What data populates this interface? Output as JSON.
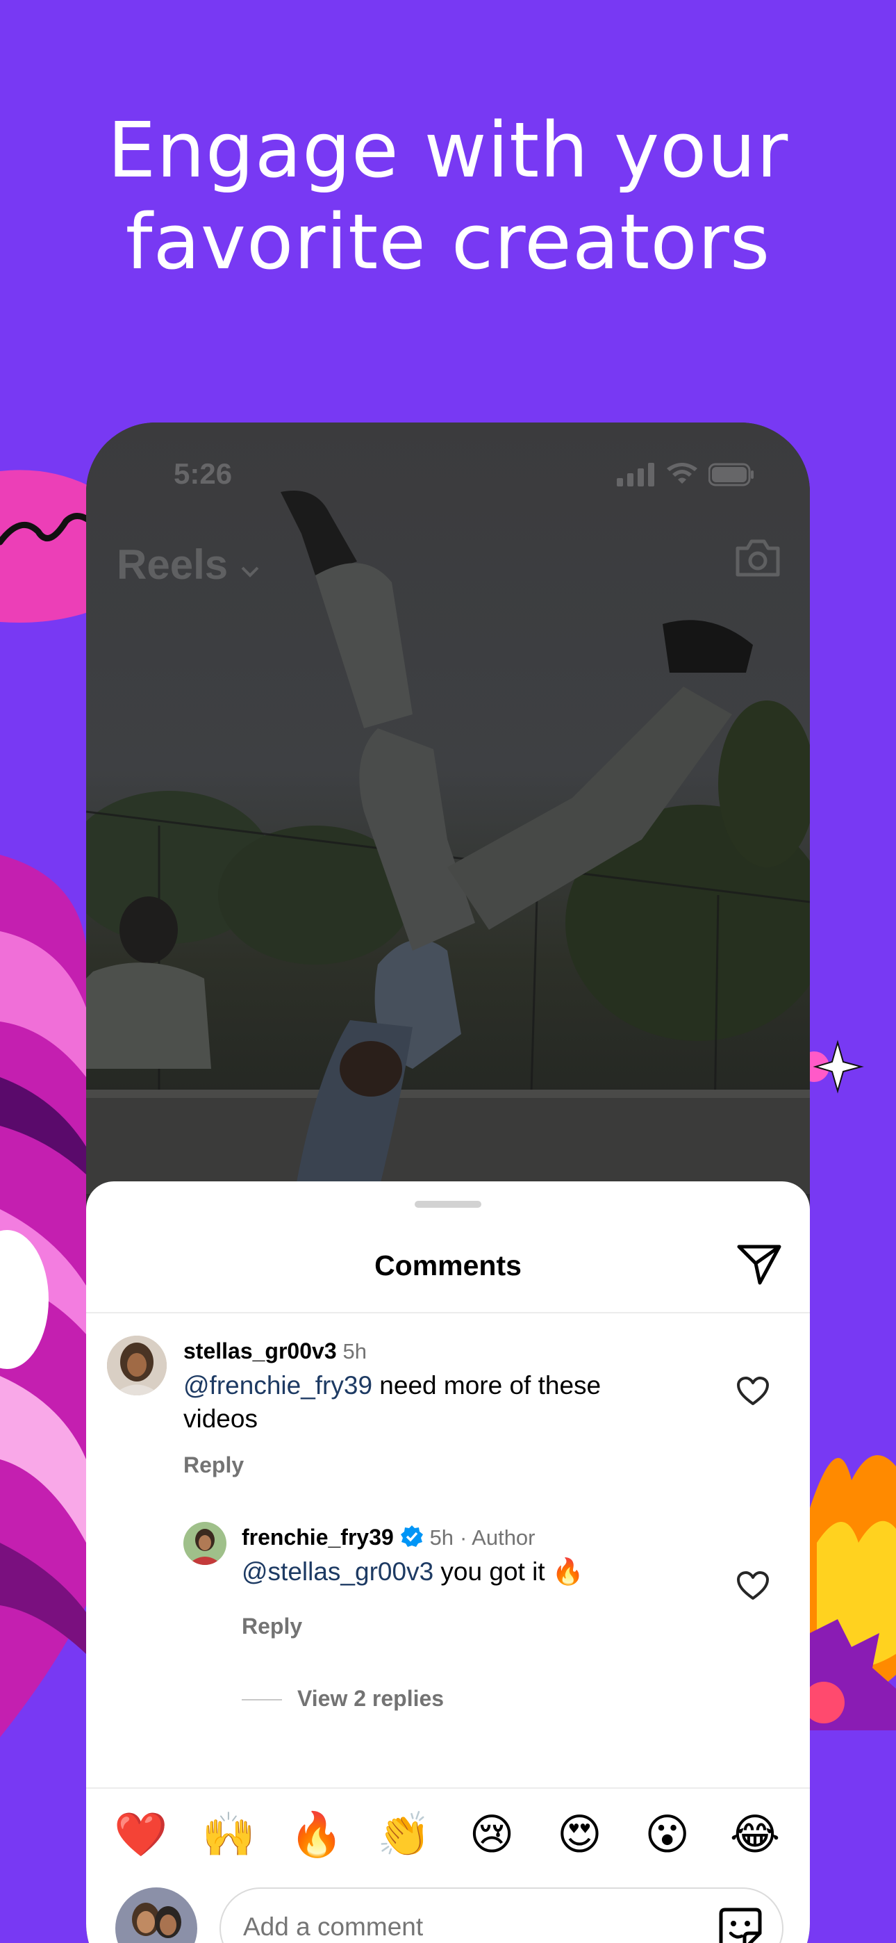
{
  "headline": {
    "line1": "Engage with your",
    "line2": "favorite creators"
  },
  "status_bar": {
    "time": "5:26"
  },
  "reels_header": {
    "title": "Reels",
    "camera_icon": "camera-icon"
  },
  "comments_sheet": {
    "title": "Comments",
    "share_icon": "paper-plane-icon",
    "comments": [
      {
        "username": "stellas_gr00v3",
        "time": "5h",
        "mention": "@frenchie_fry39",
        "text_line1": " need more of these",
        "text_line2": "videos",
        "reply_label": "Reply"
      },
      {
        "username": "frenchie_fry39",
        "verified": true,
        "time": "5h",
        "author_label": "· Author",
        "mention": "@stellas_gr00v3",
        "text": " you got it 🔥",
        "reply_label": "Reply"
      }
    ],
    "view_replies": "View 2 replies"
  },
  "emoji_bar": [
    "❤️",
    "🙌",
    "🔥",
    "👏",
    "😢",
    "😍",
    "😮",
    "😂"
  ],
  "comment_input": {
    "placeholder": "Add a comment"
  },
  "colors": {
    "background": "#7839f3",
    "mention": "#1d3a63",
    "verified": "#0095f6"
  }
}
